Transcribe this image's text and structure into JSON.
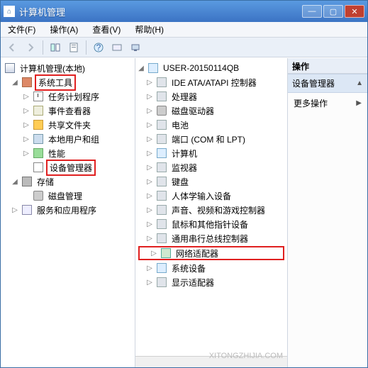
{
  "window": {
    "title": "计算机管理"
  },
  "menu": {
    "file": "文件(F)",
    "action": "操作(A)",
    "view": "查看(V)",
    "help": "帮助(H)"
  },
  "left_tree": {
    "root": "计算机管理(本地)",
    "system_tools": "系统工具",
    "task_scheduler": "任务计划程序",
    "event_viewer": "事件查看器",
    "shared_folders": "共享文件夹",
    "local_users": "本地用户和组",
    "performance": "性能",
    "device_manager": "设备管理器",
    "storage": "存储",
    "disk_mgmt": "磁盘管理",
    "services_apps": "服务和应用程序"
  },
  "mid_tree": {
    "root": "USER-20150114QB",
    "ide": "IDE ATA/ATAPI 控制器",
    "cpu": "处理器",
    "dvd": "磁盘驱动器",
    "battery": "电池",
    "ports": "端口 (COM 和 LPT)",
    "computer": "计算机",
    "monitor": "监视器",
    "keyboard": "键盘",
    "hid": "人体学输入设备",
    "sound": "声音、视频和游戏控制器",
    "mouse": "鼠标和其他指针设备",
    "usb": "通用串行总线控制器",
    "network": "网络适配器",
    "system": "系统设备",
    "display": "显示适配器"
  },
  "right": {
    "header": "操作",
    "section": "设备管理器",
    "more": "更多操作"
  },
  "watermark": "XITONGZHIJIA.COM"
}
